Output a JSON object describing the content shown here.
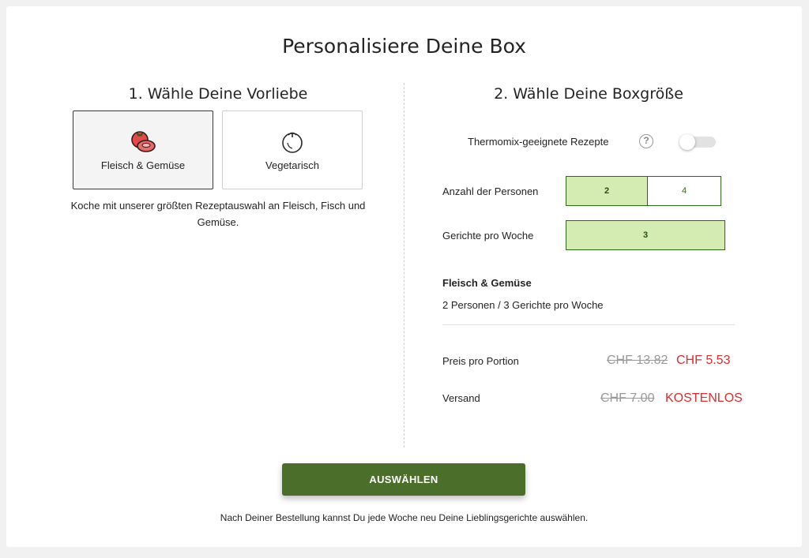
{
  "page": {
    "title": "Personalisiere Deine Box"
  },
  "preference": {
    "heading": "1. Wähle Deine Vorliebe",
    "options": [
      {
        "label": "Fleisch & Gemüse",
        "icon": "meat-vegetable-icon",
        "selected": true
      },
      {
        "label": "Vegetarisch",
        "icon": "tomato-icon",
        "selected": false
      }
    ],
    "description": "Koche mit unserer größten Rezeptauswahl an Fleisch, Fisch und Gemüse."
  },
  "box_size": {
    "heading": "2. Wähle Deine Boxgröße",
    "thermomix": {
      "label": "Thermomix-geeignete Rezepte",
      "help_icon": "?",
      "enabled": false
    },
    "persons": {
      "label": "Anzahl der Personen",
      "options": [
        "2",
        "4"
      ],
      "selected": "2"
    },
    "meals": {
      "label": "Gerichte pro Woche",
      "options": [
        "3"
      ],
      "selected": "3"
    }
  },
  "summary": {
    "title": "Fleisch & Gemüse",
    "detail": "2 Personen / 3 Gerichte pro Woche",
    "price_label": "Preis pro Portion",
    "price_old": "CHF 13.82",
    "price_new": "CHF 5.53",
    "shipping_label": "Versand",
    "shipping_old": "CHF 7.00",
    "shipping_new": "KOSTENLOS"
  },
  "cta": {
    "label": "AUSWÄHLEN"
  },
  "footnote": "Nach Deiner Bestellung kannst Du jede Woche neu Deine Lieblingsgerichte auswählen.",
  "colors": {
    "accent_green": "#4b6e2a",
    "active_segment": "#d4ebb1",
    "price_red": "#d72e2e"
  }
}
